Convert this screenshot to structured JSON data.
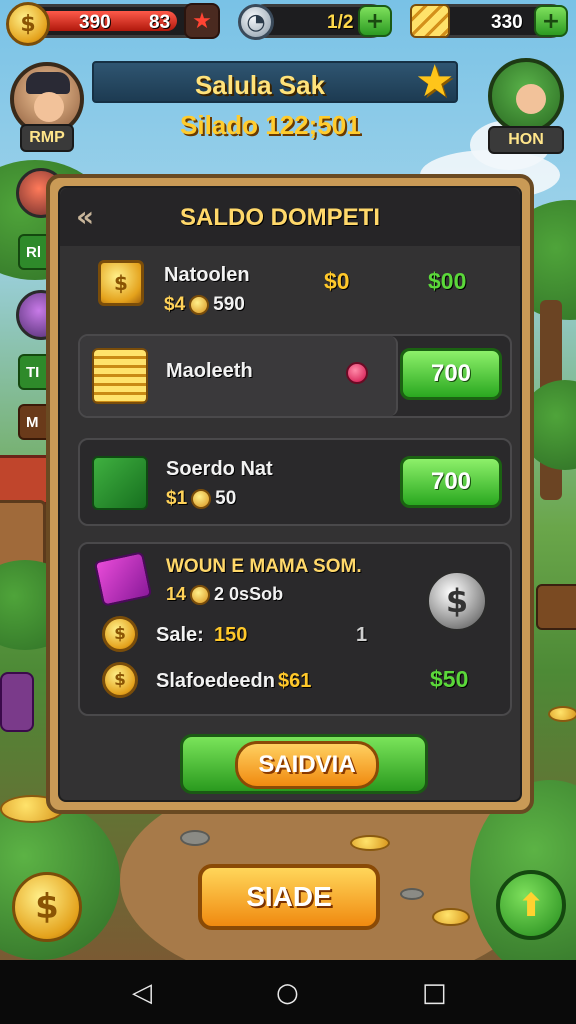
{
  "top_bar": {
    "health_value": "390",
    "health_level": "83",
    "health_fill_percent": 70,
    "timer_value": "1/2",
    "gold_value": "330",
    "coin_symbol": "$",
    "add_symbol": "+",
    "star_glyph": "★",
    "clock_glyph": "◔"
  },
  "header": {
    "banner_title": "Salula Sak",
    "banner_star": "★",
    "subtitle": "Silado 122;501"
  },
  "left_player": {
    "tag_label": "RMP"
  },
  "right_player": {
    "tag_label": "HON"
  },
  "side_buttons": [
    {
      "label": "Rl"
    },
    {
      "label": "TI"
    },
    {
      "label": "M"
    }
  ],
  "dialog": {
    "back_glyph": "«",
    "title": "SALDO DOMPETI",
    "items": [
      {
        "name": "Natoolen",
        "sub_prefix": "$4",
        "sub_value": "590",
        "price_gold": "$0",
        "price_green": "$00"
      },
      {
        "name": "Maoleeth",
        "button_label": "700"
      },
      {
        "name": "Soerdo Nat",
        "sub_prefix": "$1",
        "sub_value": "50",
        "button_label": "700"
      }
    ],
    "summary": {
      "title": "WOUN E MAMA SOM.",
      "sub_prefix": "14",
      "sub_value": "2 0sSob",
      "sale_label": "Sale:",
      "sale_value": "150",
      "sale_count": "1",
      "total_label": "Slafoedeedn",
      "total_value": "$61",
      "total_price": "$50",
      "badge_glyph": "$"
    },
    "confirm_label": "SAIDVIA"
  },
  "bottom": {
    "main_button": "SIADE",
    "coin_glyph": "$",
    "up_glyph": "⬆",
    "corner_glyph": "✦"
  },
  "navbar": {
    "back_glyph": "◁",
    "home_glyph": "○",
    "recent_glyph": "□"
  },
  "colors": {
    "accent_gold": "#ffd86a",
    "buy_green": "#2aa820",
    "panel": "#333233"
  }
}
